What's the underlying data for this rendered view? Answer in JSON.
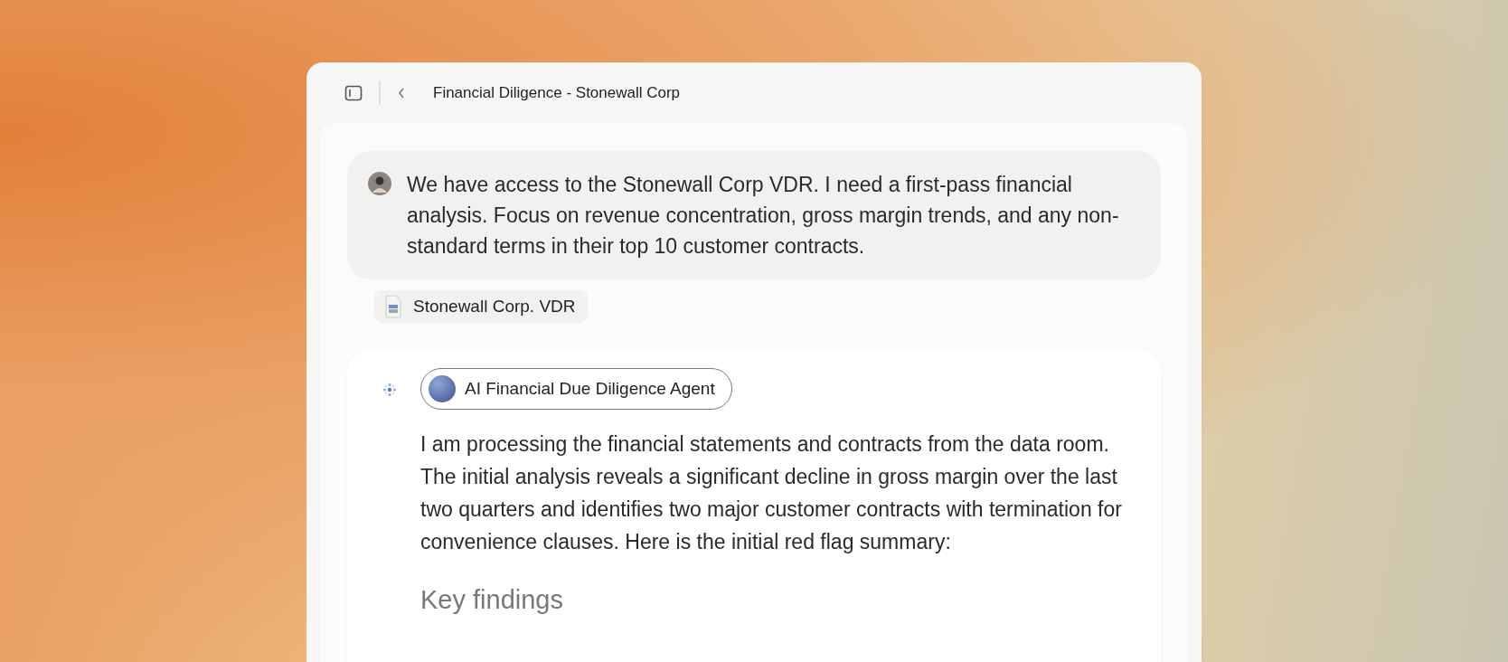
{
  "window": {
    "title": "Financial Diligence - Stonewall Corp"
  },
  "user_message": {
    "text": "We have access to the Stonewall Corp VDR. I need a first-pass financial analysis. Focus on revenue concentration, gross margin trends, and any non-standard terms in their top 10 customer contracts."
  },
  "attachments": [
    {
      "label": "Stonewall Corp. VDR"
    }
  ],
  "agent_message": {
    "agent_name": "AI Financial Due Diligence Agent",
    "text": "I am processing the financial statements and contracts from the data room. The initial analysis reveals a significant decline in gross margin over the last two quarters and identifies two major customer contracts with termination for convenience clauses. Here is the initial red flag summary:",
    "heading": "Key findings"
  }
}
